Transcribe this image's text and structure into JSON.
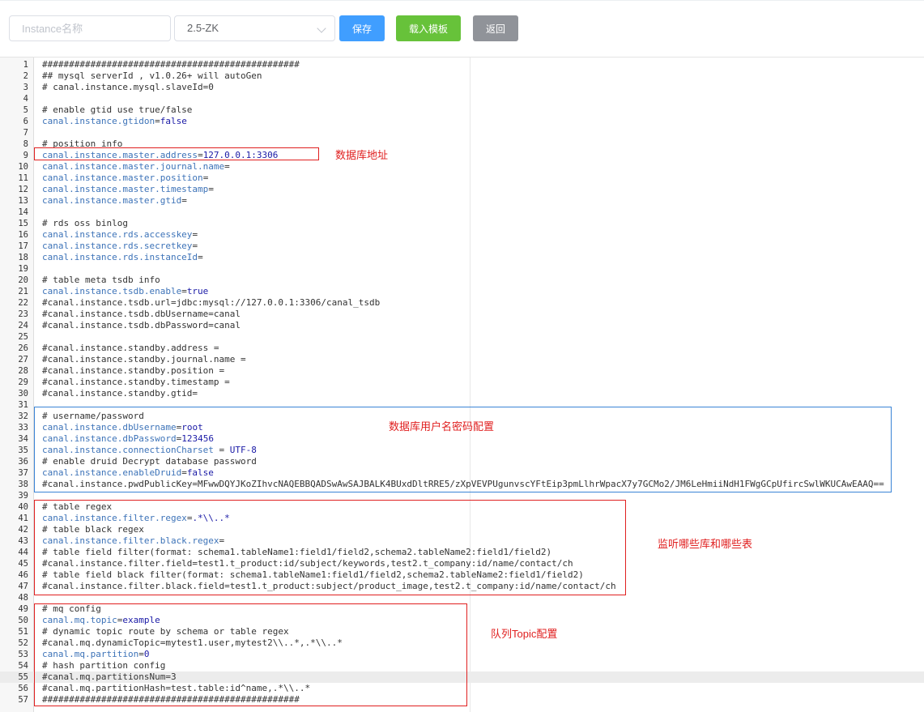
{
  "toolbar": {
    "name_placeholder": "Instance名称",
    "version_value": "2.5-ZK",
    "save_label": "保存",
    "template_label": "载入模板",
    "back_label": "返回"
  },
  "editor": {
    "active_line": 55,
    "lines": [
      {
        "n": "1",
        "k": "c",
        "t": "################################################"
      },
      {
        "n": "2",
        "k": "c",
        "t": "## mysql serverId , v1.0.26+ will autoGen"
      },
      {
        "n": "3",
        "k": "c",
        "t": "# canal.instance.mysql.slaveId=0"
      },
      {
        "n": "4",
        "k": "b",
        "t": ""
      },
      {
        "n": "5",
        "k": "c",
        "t": "# enable gtid use true/false"
      },
      {
        "n": "6",
        "k": "p",
        "key": "canal.instance.gtidon",
        "val": "false"
      },
      {
        "n": "7",
        "k": "b",
        "t": ""
      },
      {
        "n": "8",
        "k": "c",
        "t": "# position info"
      },
      {
        "n": "9",
        "k": "p",
        "key": "canal.instance.master.address",
        "val": "127.0.0.1:3306"
      },
      {
        "n": "10",
        "k": "p",
        "key": "canal.instance.master.journal.name",
        "val": ""
      },
      {
        "n": "11",
        "k": "p",
        "key": "canal.instance.master.position",
        "val": ""
      },
      {
        "n": "12",
        "k": "p",
        "key": "canal.instance.master.timestamp",
        "val": ""
      },
      {
        "n": "13",
        "k": "p",
        "key": "canal.instance.master.gtid",
        "val": ""
      },
      {
        "n": "14",
        "k": "b",
        "t": ""
      },
      {
        "n": "15",
        "k": "c",
        "t": "# rds oss binlog"
      },
      {
        "n": "16",
        "k": "p",
        "key": "canal.instance.rds.accesskey",
        "val": ""
      },
      {
        "n": "17",
        "k": "p",
        "key": "canal.instance.rds.secretkey",
        "val": ""
      },
      {
        "n": "18",
        "k": "p",
        "key": "canal.instance.rds.instanceId",
        "val": ""
      },
      {
        "n": "19",
        "k": "b",
        "t": ""
      },
      {
        "n": "20",
        "k": "c",
        "t": "# table meta tsdb info"
      },
      {
        "n": "21",
        "k": "p",
        "key": "canal.instance.tsdb.enable",
        "val": "true"
      },
      {
        "n": "22",
        "k": "c",
        "t": "#canal.instance.tsdb.url=jdbc:mysql://127.0.0.1:3306/canal_tsdb"
      },
      {
        "n": "23",
        "k": "c",
        "t": "#canal.instance.tsdb.dbUsername=canal"
      },
      {
        "n": "24",
        "k": "c",
        "t": "#canal.instance.tsdb.dbPassword=canal"
      },
      {
        "n": "25",
        "k": "b",
        "t": ""
      },
      {
        "n": "26",
        "k": "c",
        "t": "#canal.instance.standby.address ="
      },
      {
        "n": "27",
        "k": "c",
        "t": "#canal.instance.standby.journal.name ="
      },
      {
        "n": "28",
        "k": "c",
        "t": "#canal.instance.standby.position ="
      },
      {
        "n": "29",
        "k": "c",
        "t": "#canal.instance.standby.timestamp ="
      },
      {
        "n": "30",
        "k": "c",
        "t": "#canal.instance.standby.gtid="
      },
      {
        "n": "31",
        "k": "b",
        "t": ""
      },
      {
        "n": "32",
        "k": "c",
        "t": "# username/password"
      },
      {
        "n": "33",
        "k": "p",
        "key": "canal.instance.dbUsername",
        "val": "root"
      },
      {
        "n": "34",
        "k": "p",
        "key": "canal.instance.dbPassword",
        "val": "123456"
      },
      {
        "n": "35",
        "k": "p",
        "key": "canal.instance.connectionCharset",
        "eq": " = ",
        "val": "UTF-8"
      },
      {
        "n": "36",
        "k": "c",
        "t": "# enable druid Decrypt database password"
      },
      {
        "n": "37",
        "k": "p",
        "key": "canal.instance.enableDruid",
        "val": "false"
      },
      {
        "n": "38",
        "k": "c",
        "t": "#canal.instance.pwdPublicKey=MFwwDQYJKoZIhvcNAQEBBQADSwAwSAJBALK4BUxdDltRRE5/zXpVEVPUgunvscYFtEip3pmLlhrWpacX7y7GCMo2/JM6LeHmiiNdH1FWgGCpUfircSwlWKUCAwEAAQ=="
      },
      {
        "n": "39",
        "k": "b",
        "t": ""
      },
      {
        "n": "40",
        "k": "c",
        "t": "# table regex"
      },
      {
        "n": "41",
        "k": "p",
        "key": "canal.instance.filter.regex",
        "val": ".*\\\\..*"
      },
      {
        "n": "42",
        "k": "c",
        "t": "# table black regex"
      },
      {
        "n": "43",
        "k": "p",
        "key": "canal.instance.filter.black.regex",
        "val": ""
      },
      {
        "n": "44",
        "k": "c",
        "t": "# table field filter(format: schema1.tableName1:field1/field2,schema2.tableName2:field1/field2)"
      },
      {
        "n": "45",
        "k": "c",
        "t": "#canal.instance.filter.field=test1.t_product:id/subject/keywords,test2.t_company:id/name/contact/ch"
      },
      {
        "n": "46",
        "k": "c",
        "t": "# table field black filter(format: schema1.tableName1:field1/field2,schema2.tableName2:field1/field2)"
      },
      {
        "n": "47",
        "k": "c",
        "t": "#canal.instance.filter.black.field=test1.t_product:subject/product_image,test2.t_company:id/name/contact/ch"
      },
      {
        "n": "48",
        "k": "b",
        "t": ""
      },
      {
        "n": "49",
        "k": "c",
        "t": "# mq config"
      },
      {
        "n": "50",
        "k": "p",
        "key": "canal.mq.topic",
        "val": "example"
      },
      {
        "n": "51",
        "k": "c",
        "t": "# dynamic topic route by schema or table regex"
      },
      {
        "n": "52",
        "k": "c",
        "t": "#canal.mq.dynamicTopic=mytest1.user,mytest2\\\\..*,.*\\\\..*"
      },
      {
        "n": "53",
        "k": "p",
        "key": "canal.mq.partition",
        "val": "0"
      },
      {
        "n": "54",
        "k": "c",
        "t": "# hash partition config"
      },
      {
        "n": "55",
        "k": "c",
        "t": "#canal.mq.partitionsNum=3"
      },
      {
        "n": "56",
        "k": "c",
        "t": "#canal.mq.partitionHash=test.table:id^name,.*\\\\..*"
      },
      {
        "n": "57",
        "k": "c",
        "t": "################################################"
      }
    ]
  },
  "annotations": {
    "db_address": "数据库地址",
    "db_credentials": "数据库用户名密码配置",
    "tables_filter": "监听哪些库和哪些表",
    "mq_topic": "队列Topic配置"
  },
  "colors": {
    "primary": "#409eff",
    "success": "#67c23a",
    "info": "#909399",
    "annotation_red": "#e02020",
    "annotation_blue": "#3a84d6"
  }
}
